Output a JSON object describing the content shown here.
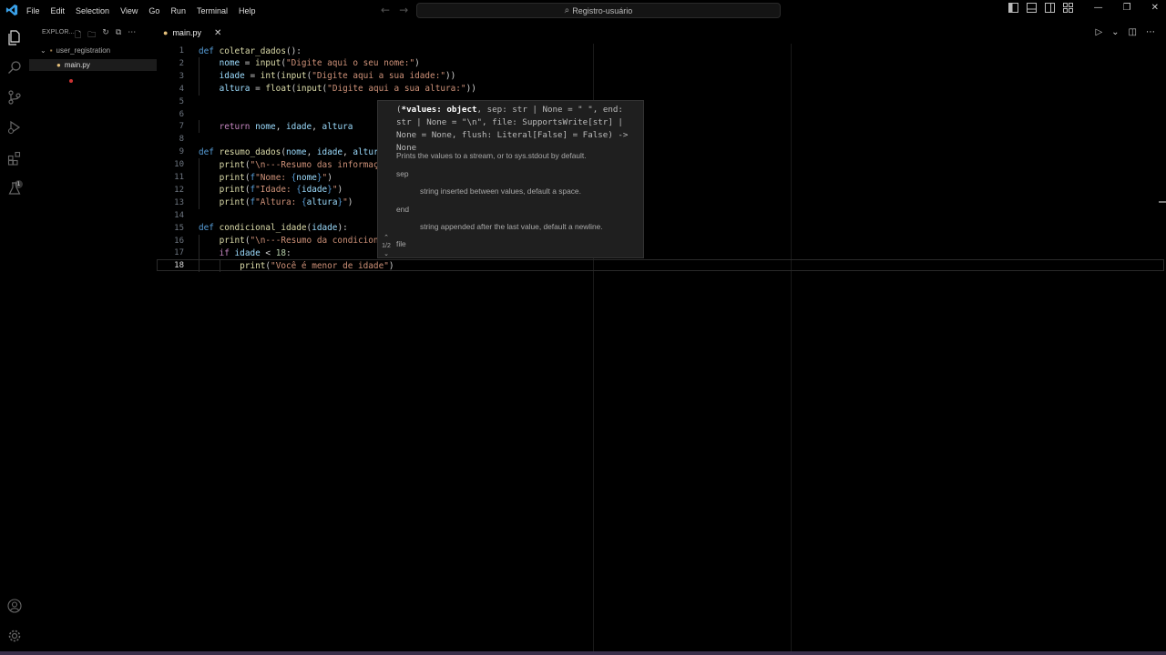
{
  "titlebar": {
    "menu": [
      "File",
      "Edit",
      "Selection",
      "View",
      "Go",
      "Run",
      "Terminal",
      "Help"
    ],
    "search_text": "Registro-usuário"
  },
  "sidebar": {
    "header": "EXPLOR...",
    "folder": "user_registration",
    "file": "main.py"
  },
  "activity_badge": "1",
  "tab": {
    "label": "main.py"
  },
  "code_lines": [
    {
      "n": "1",
      "t": "def coletar_dados():"
    },
    {
      "n": "2",
      "t": "    nome = input(\"Digite aqui o seu nome:\")"
    },
    {
      "n": "3",
      "t": "    idade = int(input(\"Digite aqui a sua idade:\"))"
    },
    {
      "n": "4",
      "t": "    altura = float(input(\"Digite aqui a sua altura:\"))"
    },
    {
      "n": "5",
      "t": ""
    },
    {
      "n": "6",
      "t": ""
    },
    {
      "n": "7",
      "t": "    return nome, idade, altura"
    },
    {
      "n": "8",
      "t": ""
    },
    {
      "n": "9",
      "t": "def resumo_dados(nome, idade, altura"
    },
    {
      "n": "10",
      "t": "    print(\"\\n---Resumo das informaçõ"
    },
    {
      "n": "11",
      "t": "    print(f\"Nome: {nome}\")"
    },
    {
      "n": "12",
      "t": "    print(f\"Idade: {idade}\")"
    },
    {
      "n": "13",
      "t": "    print(f\"Altura: {altura}\")"
    },
    {
      "n": "14",
      "t": ""
    },
    {
      "n": "15",
      "t": "def condicional_idade(idade):"
    },
    {
      "n": "16",
      "t": "    print(\"\\n---Resumo da condiciona"
    },
    {
      "n": "17",
      "t": "    if idade < 18:"
    },
    {
      "n": "18",
      "t": "        print(\"Você é menor de idade\")"
    }
  ],
  "hover": {
    "sig_open": "(",
    "sig_bold": "*values: object",
    "sig_rest": ", sep: str | None = \" \", end: str | None = \"\\n\", file: SupportsWrite[str] | None = None, flush: Literal[False] = False) -> None",
    "desc": "Prints the values to a stream, or to sys.stdout by default.",
    "p1_name": "sep",
    "p1_desc": "string inserted between values, default a space.",
    "p2_name": "end",
    "p2_desc": "string appended after the last value, default a newline.",
    "p3_name": "file",
    "pager": "1/2"
  }
}
